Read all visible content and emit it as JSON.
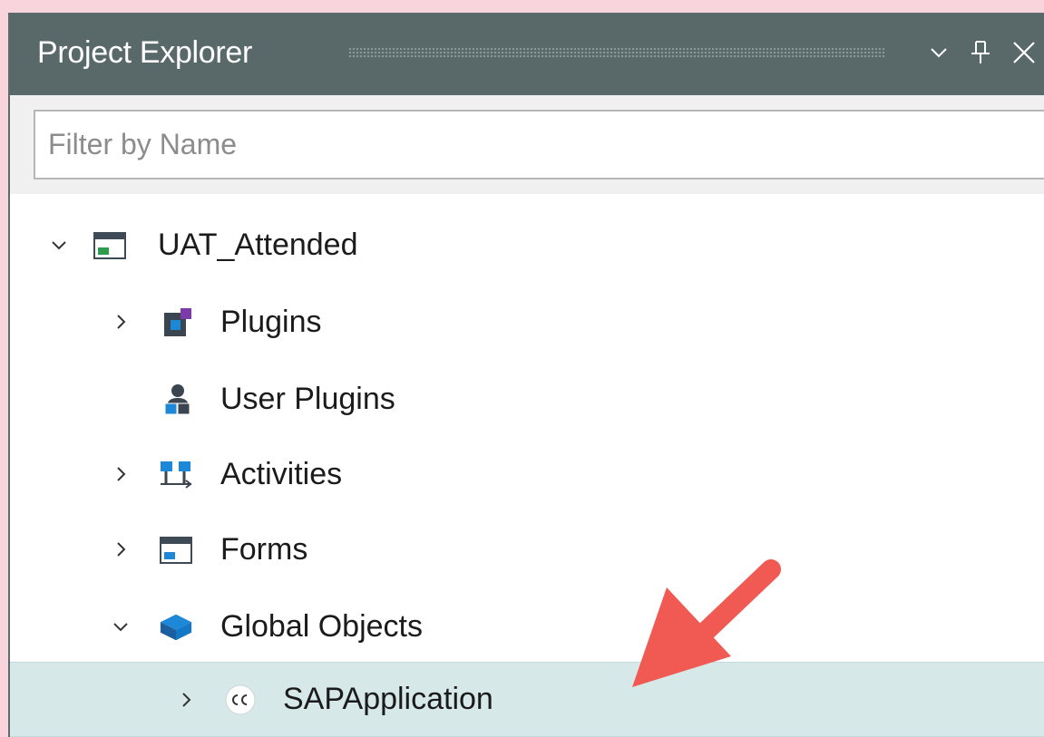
{
  "panel": {
    "title": "Project Explorer",
    "buttons": {
      "dropdown": "chevron-down-icon",
      "pin": "pin-icon",
      "close": "close-icon"
    }
  },
  "filter": {
    "placeholder": "Filter by Name",
    "value": ""
  },
  "tree": {
    "root": {
      "label": "UAT_Attended",
      "expanded": true,
      "icon": "form-window-icon"
    },
    "items": [
      {
        "label": "Plugins",
        "expanded": false,
        "icon": "plugins-icon"
      },
      {
        "label": "User Plugins",
        "icon": "user-plugins-icon"
      },
      {
        "label": "Activities",
        "expanded": false,
        "icon": "activities-icon"
      },
      {
        "label": "Forms",
        "expanded": false,
        "icon": "form-window-icon"
      },
      {
        "label": "Global Objects",
        "expanded": true,
        "icon": "global-objects-icon"
      }
    ],
    "selected": {
      "label": "SAPApplication",
      "expanded": false,
      "icon": "sap-object-icon"
    }
  },
  "colors": {
    "background": "#fad4dc",
    "titlebar": "#59696a",
    "selection": "#d7e8e9",
    "annotation_arrow": "#f05a52"
  }
}
